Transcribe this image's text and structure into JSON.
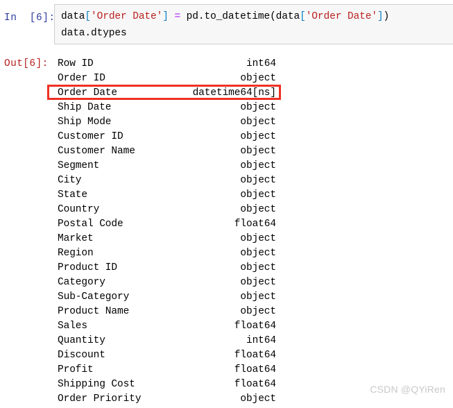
{
  "notebook": {
    "input_cell": {
      "prompt": "In  [6]:",
      "lines": [
        [
          {
            "t": "data",
            "c": "plain"
          },
          {
            "t": "[",
            "c": "brk"
          },
          {
            "t": "'Order Date'",
            "c": "str"
          },
          {
            "t": "]",
            "c": "brk"
          },
          {
            "t": " ",
            "c": "plain"
          },
          {
            "t": "=",
            "c": "op"
          },
          {
            "t": " pd.to_datetime(data",
            "c": "plain"
          },
          {
            "t": "[",
            "c": "brk"
          },
          {
            "t": "'Order Date'",
            "c": "str"
          },
          {
            "t": "]",
            "c": "brk"
          },
          {
            "t": ")",
            "c": "plain"
          }
        ],
        [
          {
            "t": "data.dtypes",
            "c": "plain"
          }
        ]
      ]
    },
    "output_cell": {
      "prompt": "Out[6]:",
      "columns": [
        "name",
        "dtype"
      ],
      "rows": [
        {
          "name": "Row ID",
          "dtype": "int64"
        },
        {
          "name": "Order ID",
          "dtype": "object"
        },
        {
          "name": "Order Date",
          "dtype": "datetime64[ns]"
        },
        {
          "name": "Ship Date",
          "dtype": "object"
        },
        {
          "name": "Ship Mode",
          "dtype": "object"
        },
        {
          "name": "Customer ID",
          "dtype": "object"
        },
        {
          "name": "Customer Name",
          "dtype": "object"
        },
        {
          "name": "Segment",
          "dtype": "object"
        },
        {
          "name": "City",
          "dtype": "object"
        },
        {
          "name": "State",
          "dtype": "object"
        },
        {
          "name": "Country",
          "dtype": "object"
        },
        {
          "name": "Postal Code",
          "dtype": "float64"
        },
        {
          "name": "Market",
          "dtype": "object"
        },
        {
          "name": "Region",
          "dtype": "object"
        },
        {
          "name": "Product ID",
          "dtype": "object"
        },
        {
          "name": "Category",
          "dtype": "object"
        },
        {
          "name": "Sub-Category",
          "dtype": "object"
        },
        {
          "name": "Product Name",
          "dtype": "object"
        },
        {
          "name": "Sales",
          "dtype": "float64"
        },
        {
          "name": "Quantity",
          "dtype": "int64"
        },
        {
          "name": "Discount",
          "dtype": "float64"
        },
        {
          "name": "Profit",
          "dtype": "float64"
        },
        {
          "name": "Shipping Cost",
          "dtype": "float64"
        },
        {
          "name": "Order Priority",
          "dtype": "object"
        }
      ]
    },
    "annotation": {
      "target_row": "Order Date",
      "color": "#ee3124"
    }
  },
  "watermark": {
    "text": "CSDN @QYiRen",
    "color": "#c9c9c9"
  },
  "colors": {
    "input_prompt": "#303f9f",
    "output_prompt": "#ba2121",
    "string_literal": "#ba2121",
    "operator": "#aa22ff",
    "bracket": "#0f7fbf",
    "cell_background": "#f7f7f7",
    "cell_border": "#cfcfcf",
    "annotation": "#ee3124"
  }
}
